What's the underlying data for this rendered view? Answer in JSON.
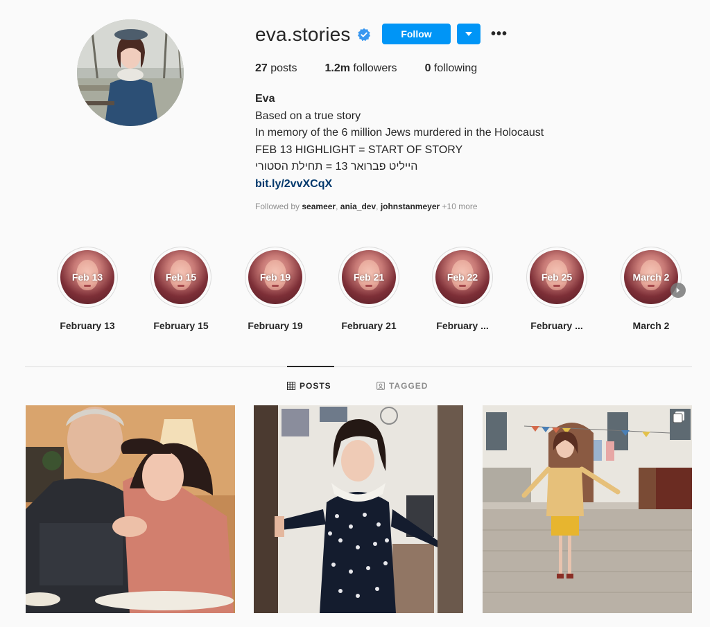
{
  "profile": {
    "username": "eva.stories",
    "verified_icon": "verified-badge-icon",
    "follow_label": "Follow",
    "more_label": "•••",
    "stats": {
      "posts_count": "27",
      "posts_label": "posts",
      "followers_count": "1.2m",
      "followers_label": "followers",
      "following_count": "0",
      "following_label": "following"
    },
    "bio": {
      "name": "Eva",
      "line1": "Based on a true story",
      "line2": "In memory of the 6 million Jews murdered in the Holocaust",
      "line3": "FEB 13 HIGHLIGHT = START OF STORY",
      "line4": "הייליט פברואר 13 = תחילת הסטורי",
      "link": "bit.ly/2vvXCqX"
    },
    "followed_by": {
      "prefix": "Followed by",
      "user1": "seameer",
      "user2": "ania_dev",
      "user3": "johnstanmeyer",
      "more": "+10 more"
    }
  },
  "highlights": [
    {
      "cover_text": "Feb 13",
      "label": "February 13"
    },
    {
      "cover_text": "Feb 15",
      "label": "February 15"
    },
    {
      "cover_text": "Feb 19",
      "label": "February 19"
    },
    {
      "cover_text": "Feb 21",
      "label": "February 21"
    },
    {
      "cover_text": "Feb 22",
      "label": "February ..."
    },
    {
      "cover_text": "Feb 25",
      "label": "February ..."
    },
    {
      "cover_text": "March 2",
      "label": "March 2"
    }
  ],
  "tabs": {
    "posts": "POSTS",
    "tagged": "TAGGED"
  },
  "colors": {
    "accent": "#0095f6",
    "background": "#fafafa",
    "text": "#262626",
    "muted": "#8e8e8e",
    "link": "#00376b"
  }
}
